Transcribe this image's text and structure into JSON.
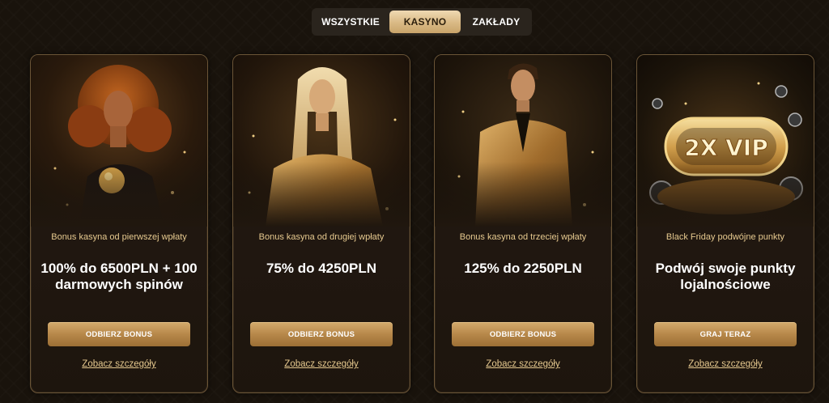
{
  "tabs": [
    {
      "label": "WSZYSTKIE",
      "active": false
    },
    {
      "label": "KASYNO",
      "active": true
    },
    {
      "label": "ZAKŁADY",
      "active": false
    }
  ],
  "cards": [
    {
      "image": "woman-curly-hair-gold-dice",
      "subtitle": "Bonus kasyna od pierwszej wpłaty",
      "title": "100% do 6500PLN + 100 darmowych spinów",
      "cta": "ODBIERZ BONUS",
      "details": "Zobacz szczegóły"
    },
    {
      "image": "woman-blonde-gold-dress",
      "subtitle": "Bonus kasyna od drugiej wpłaty",
      "title": "75% do 4250PLN",
      "cta": "ODBIERZ BONUS",
      "details": "Zobacz szczegóły"
    },
    {
      "image": "man-gold-suit",
      "subtitle": "Bonus kasyna od trzeciej wpłaty",
      "title": "125% do 2250PLN",
      "cta": "ODBIERZ BONUS",
      "details": "Zobacz szczegóły"
    },
    {
      "image": "vip-badge-chips",
      "badge_text": "2X VIP",
      "subtitle": "Black Friday podwójne punkty",
      "title": "Podwój swoje punkty lojalnościowe",
      "cta": "GRAJ TERAZ",
      "details": "Zobacz szczegóły"
    }
  ],
  "colors": {
    "background": "#19130c",
    "accent_gold": "#c9a46a",
    "subtitle_gold": "#e6c98f",
    "card_border": "#6b5537"
  }
}
